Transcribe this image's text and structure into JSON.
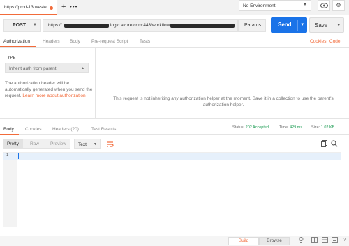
{
  "tab": {
    "title": "https://prod-13.weste"
  },
  "tabbar": {
    "plus": "+",
    "more": "•••"
  },
  "environment": {
    "selected": "No Environment"
  },
  "request": {
    "method": "POST",
    "url_start": "https://",
    "url_mid": "logic.azure.com:443/workflows",
    "params_label": "Params",
    "send_label": "Send",
    "save_label": "Save"
  },
  "request_tabs": [
    "Authorization",
    "Headers",
    "Body",
    "Pre-request Script",
    "Tests"
  ],
  "request_links": {
    "cookies": "Cookies",
    "code": "Code"
  },
  "auth": {
    "type_label": "TYPE",
    "type_value": "Inherit auth from parent",
    "description": "The authorization header will be automatically generated when you send the request.",
    "learn_more": "Learn more about authorization",
    "message": "This request is not inheriting any authorization helper at the moment. Save it in a collection to use the parent's authorization helper."
  },
  "response_tabs": [
    "Body",
    "Cookies",
    "Headers (20)",
    "Test Results"
  ],
  "response_status": {
    "status_label": "Status:",
    "status_value": "202 Accepted",
    "time_label": "Time:",
    "time_value": "429 ms",
    "size_label": "Size:",
    "size_value": "1.02 KB"
  },
  "response_formats": [
    "Pretty",
    "Raw",
    "Preview"
  ],
  "response_text_select": "Text",
  "editor": {
    "line_number": "1"
  },
  "bottom": {
    "build": "Build",
    "browse": "Browse"
  },
  "colors": {
    "accent": "#f26b3a",
    "send": "#1a73e8",
    "status_ok": "#1f9d55"
  }
}
